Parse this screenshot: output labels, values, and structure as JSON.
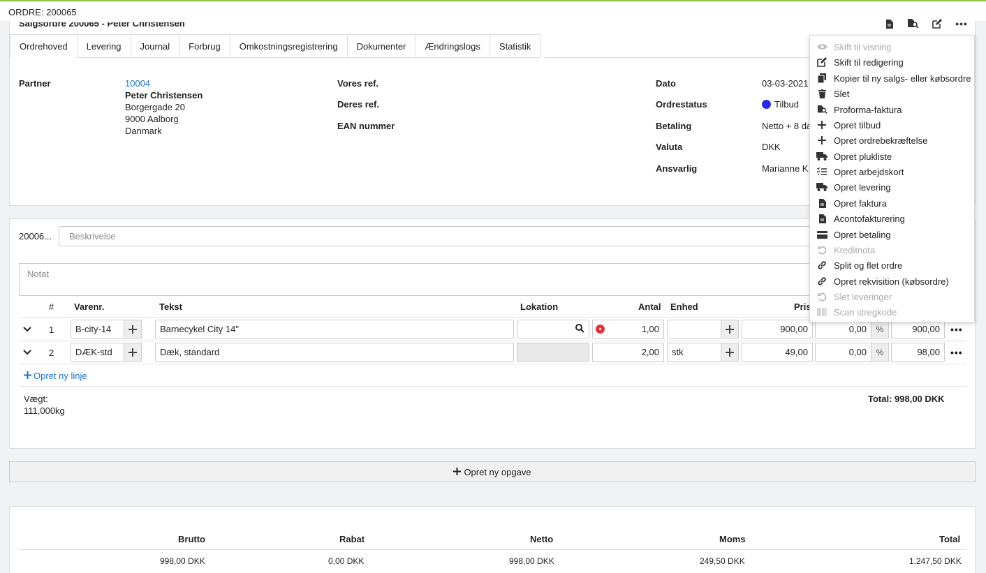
{
  "header": {
    "title": "ORDRE: 200065",
    "subtitle": "Salgsordre 200065 - Peter Christensen"
  },
  "tabs": [
    "Ordrehoved",
    "Levering",
    "Journal",
    "Forbrug",
    "Omkostningsregistrering",
    "Dokumenter",
    "Ændringslogs",
    "Statistik"
  ],
  "order": {
    "partner_label": "Partner",
    "partner_no": "10004",
    "partner_name": "Peter Christensen",
    "partner_street": "Borgergade 20",
    "partner_city": "9000 Aalborg",
    "partner_country": "Danmark",
    "vores_ref_label": "Vores ref.",
    "deres_ref_label": "Deres ref.",
    "ean_label": "EAN nummer",
    "dato_label": "Dato",
    "dato": "03-03-2021",
    "status_label": "Ordrestatus",
    "status": "Tilbud",
    "status_color": "#2a2ae6",
    "betaling_label": "Betaling",
    "betaling": "Netto + 8 da",
    "valuta_label": "Valuta",
    "valuta": "DKK",
    "ansvarlig_label": "Ansvarlig",
    "ansvarlig": "Marianne K."
  },
  "task": {
    "id": "20006...",
    "desc_placeholder": "Beskrivelse",
    "note_placeholder": "Notat",
    "columns": {
      "nr": "#",
      "varenr": "Varenr.",
      "tekst": "Tekst",
      "lokation": "Lokation",
      "antal": "Antal",
      "enhed": "Enhed",
      "pris": "Pris"
    },
    "lines": [
      {
        "nr": "1",
        "varenr": "B-city-14",
        "tekst": "Barnecykel City 14\"",
        "antal": "1,00",
        "enhed": "",
        "pris": "900,00",
        "rabat": "0,00",
        "total": "900,00"
      },
      {
        "nr": "2",
        "varenr": "DÆK-std",
        "tekst": "Dæk, standard",
        "antal": "2,00",
        "enhed": "stk",
        "pris": "49,00",
        "rabat": "0,00",
        "total": "98,00"
      }
    ],
    "pct_label": "%",
    "new_line": "Opret ny linje",
    "weight_label": "Vægt:",
    "weight": "111,000kg",
    "total": "Total: 998,00 DKK"
  },
  "new_task": "Opret ny opgave",
  "summary": {
    "headers": [
      "Brutto",
      "Rabat",
      "Netto",
      "Moms",
      "Total"
    ],
    "values": [
      "998,00 DKK",
      "0,00 DKK",
      "998,00 DKK",
      "249,50 DKK",
      "1.247,50 DKK"
    ]
  },
  "menu": [
    {
      "label": "Skift til visning",
      "icon": "eye-icon",
      "disabled": true
    },
    {
      "label": "Skift til redigering",
      "icon": "edit-icon",
      "disabled": false
    },
    {
      "label": "Kopier til ny salgs- eller købsordre",
      "icon": "copy-icon",
      "disabled": false
    },
    {
      "label": "Slet",
      "icon": "trash-icon",
      "disabled": false
    },
    {
      "label": "Proforma-faktura",
      "icon": "search-document-icon",
      "disabled": false
    },
    {
      "label": "Opret tilbud",
      "icon": "plus-icon",
      "disabled": false
    },
    {
      "label": "Opret ordrebekræftelse",
      "icon": "plus-icon",
      "disabled": false
    },
    {
      "label": "Opret plukliste",
      "icon": "truck-icon",
      "disabled": false
    },
    {
      "label": "Opret arbejdskort",
      "icon": "checklist-icon",
      "disabled": false
    },
    {
      "label": "Opret levering",
      "icon": "truck-icon",
      "disabled": false
    },
    {
      "label": "Opret faktura",
      "icon": "document-icon",
      "disabled": false
    },
    {
      "label": "Acontofakturering",
      "icon": "document-icon",
      "disabled": false
    },
    {
      "label": "Opret betaling",
      "icon": "credit-card-icon",
      "disabled": false
    },
    {
      "label": "Kreditnota",
      "icon": "undo-icon",
      "disabled": true
    },
    {
      "label": "Split og flet ordre",
      "icon": "link-icon",
      "disabled": false
    },
    {
      "label": "Opret rekvisition (købsordre)",
      "icon": "link-icon",
      "disabled": false
    },
    {
      "label": "Slet leveringer",
      "icon": "undo-icon",
      "disabled": true
    },
    {
      "label": "Scan stregkode",
      "icon": "barcode-icon",
      "disabled": true
    }
  ]
}
